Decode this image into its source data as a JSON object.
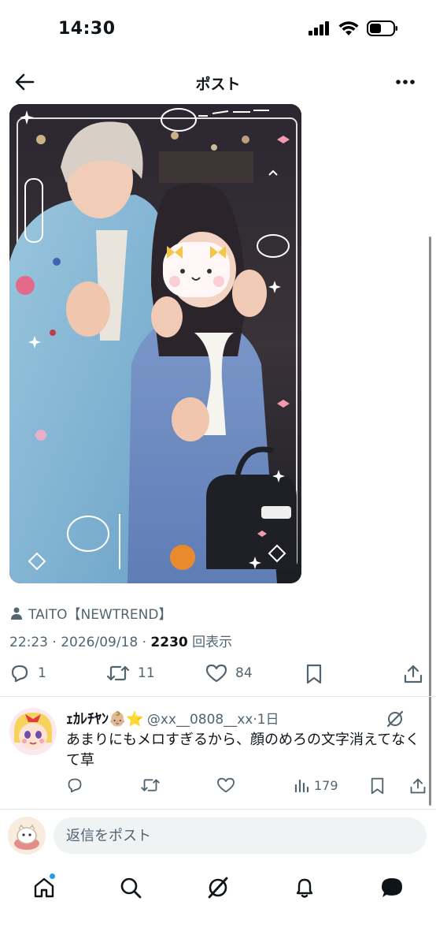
{
  "status_bar": {
    "time": "14:30"
  },
  "header": {
    "title": "ポスト"
  },
  "post": {
    "author": "TAITO【NEWTREND】",
    "datetime": "22:23 · 2026/09/18 · ",
    "views_count": "2230",
    "views_label": " 回表示",
    "replies": "1",
    "reposts": "11",
    "likes": "84"
  },
  "reply": {
    "name": "ｪｶﾚﾁﾔﾝ👶🏼⭐️",
    "handle": "@xx__0808__xx·1日",
    "text": "あまりにもメロすぎるから、顔のめろの文字消えてなくて草",
    "views": "179"
  },
  "compose": {
    "placeholder": "返信をポスト"
  },
  "colors": {
    "accent": "#1d9bf0",
    "text": "#0f1419",
    "muted": "#536471"
  }
}
